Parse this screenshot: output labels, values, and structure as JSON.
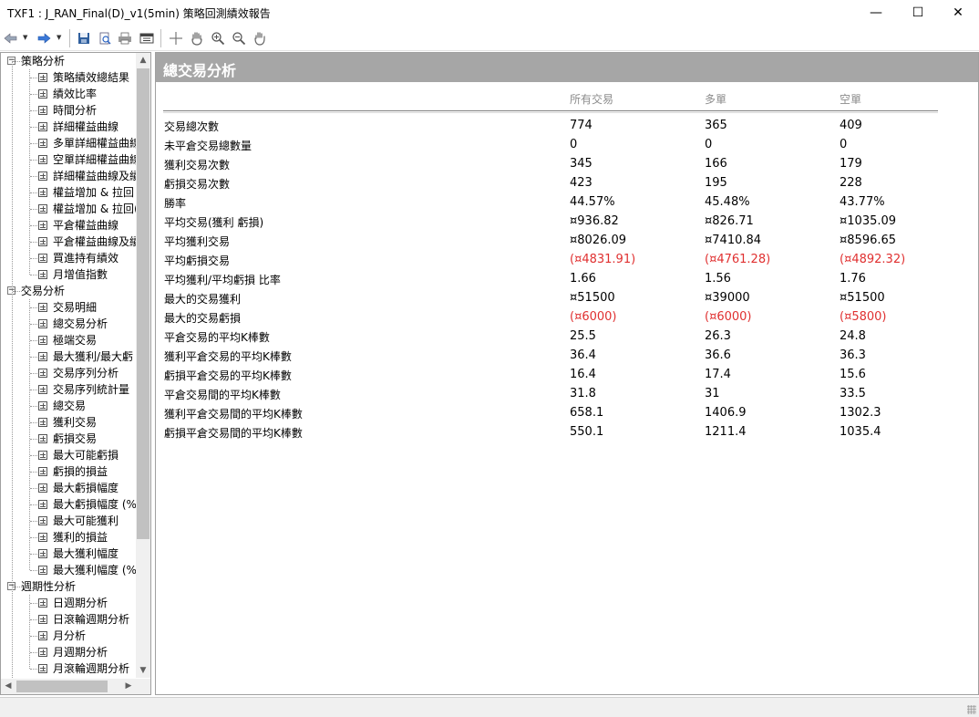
{
  "window": {
    "title": "TXF1 : J_RAN_Final(D)_v1(5min) 策略回測績效報告",
    "minimize_glyph": "—",
    "maximize_glyph": "☐",
    "close_glyph": "✕"
  },
  "toolbar": {
    "icons": [
      "back-icon",
      "forward-icon",
      "save-icon",
      "print-preview-icon",
      "print-icon",
      "options-icon",
      "crosshair-icon",
      "hand-pan-icon",
      "zoom-in-icon",
      "zoom-out-icon",
      "reset-zoom-icon"
    ]
  },
  "tree": {
    "groups": [
      {
        "label": "策略分析",
        "expander": "−",
        "items": [
          "策略績效總結果",
          "績效比率",
          "時間分析",
          "詳細權益曲線",
          "多單詳細權益曲線",
          "空單詳細權益曲線",
          "詳細權益曲線及績",
          "權益增加 & 拉回",
          "權益增加 & 拉回(",
          "平倉權益曲線",
          "平倉權益曲線及績",
          "買進持有績效",
          "月增值指數"
        ]
      },
      {
        "label": "交易分析",
        "expander": "−",
        "items": [
          "交易明細",
          "總交易分析",
          "極端交易",
          "最大獲利/最大虧",
          "交易序列分析",
          "交易序列統計量",
          "總交易",
          "獲利交易",
          "虧損交易",
          "最大可能虧損",
          "虧損的損益",
          "最大虧損幅度",
          "最大虧損幅度 (%",
          "最大可能獲利",
          "獲利的損益",
          "最大獲利幅度",
          "最大獲利幅度 (%"
        ]
      },
      {
        "label": "週期性分析",
        "expander": "−",
        "items": [
          "日週期分析",
          "日滾輪週期分析",
          "月分析",
          "月週期分析",
          "月滾輪週期分析"
        ]
      }
    ],
    "scroll_up": "▲",
    "scroll_down": "▼",
    "scroll_left": "◀",
    "scroll_right": "▶"
  },
  "report": {
    "title": "總交易分析",
    "columns": [
      "所有交易",
      "多單",
      "空單"
    ],
    "rows": [
      {
        "label": "交易總次數",
        "values": [
          "774",
          "365",
          "409"
        ],
        "negative": false
      },
      {
        "label": "未平倉交易總數量",
        "values": [
          "0",
          "0",
          "0"
        ],
        "negative": false
      },
      {
        "label": "獲利交易次數",
        "values": [
          "345",
          "166",
          "179"
        ],
        "negative": false
      },
      {
        "label": "虧損交易次數",
        "values": [
          "423",
          "195",
          "228"
        ],
        "negative": false
      },
      {
        "label": "勝率",
        "values": [
          "44.57%",
          "45.48%",
          "43.77%"
        ],
        "negative": false
      },
      {
        "label": "平均交易(獲利 虧損)",
        "values": [
          "¤936.82",
          "¤826.71",
          "¤1035.09"
        ],
        "negative": false
      },
      {
        "label": "平均獲利交易",
        "values": [
          "¤8026.09",
          "¤7410.84",
          "¤8596.65"
        ],
        "negative": false
      },
      {
        "label": "平均虧損交易",
        "values": [
          "(¤4831.91)",
          "(¤4761.28)",
          "(¤4892.32)"
        ],
        "negative": true
      },
      {
        "label": "平均獲利/平均虧損 比率",
        "values": [
          "1.66",
          "1.56",
          "1.76"
        ],
        "negative": false
      },
      {
        "label": "最大的交易獲利",
        "values": [
          "¤51500",
          "¤39000",
          "¤51500"
        ],
        "negative": false
      },
      {
        "label": "最大的交易虧損",
        "values": [
          "(¤6000)",
          "(¤6000)",
          "(¤5800)"
        ],
        "negative": true
      },
      {
        "label": "平倉交易的平均K棒數",
        "values": [
          "25.5",
          "26.3",
          "24.8"
        ],
        "negative": false
      },
      {
        "label": "獲利平倉交易的平均K棒數",
        "values": [
          "36.4",
          "36.6",
          "36.3"
        ],
        "negative": false
      },
      {
        "label": "虧損平倉交易的平均K棒數",
        "values": [
          "16.4",
          "17.4",
          "15.6"
        ],
        "negative": false
      },
      {
        "label": "平倉交易間的平均K棒數",
        "values": [
          "31.8",
          "31",
          "33.5"
        ],
        "negative": false
      },
      {
        "label": "獲利平倉交易間的平均K棒數",
        "values": [
          "658.1",
          "1406.9",
          "1302.3"
        ],
        "negative": false
      },
      {
        "label": "虧損平倉交易間的平均K棒數",
        "values": [
          "550.1",
          "1211.4",
          "1035.4"
        ],
        "negative": false
      }
    ]
  },
  "colors": {
    "header_bg": "#a6a6a6",
    "negative": "#e03030",
    "column_header": "#8c8c8c"
  }
}
